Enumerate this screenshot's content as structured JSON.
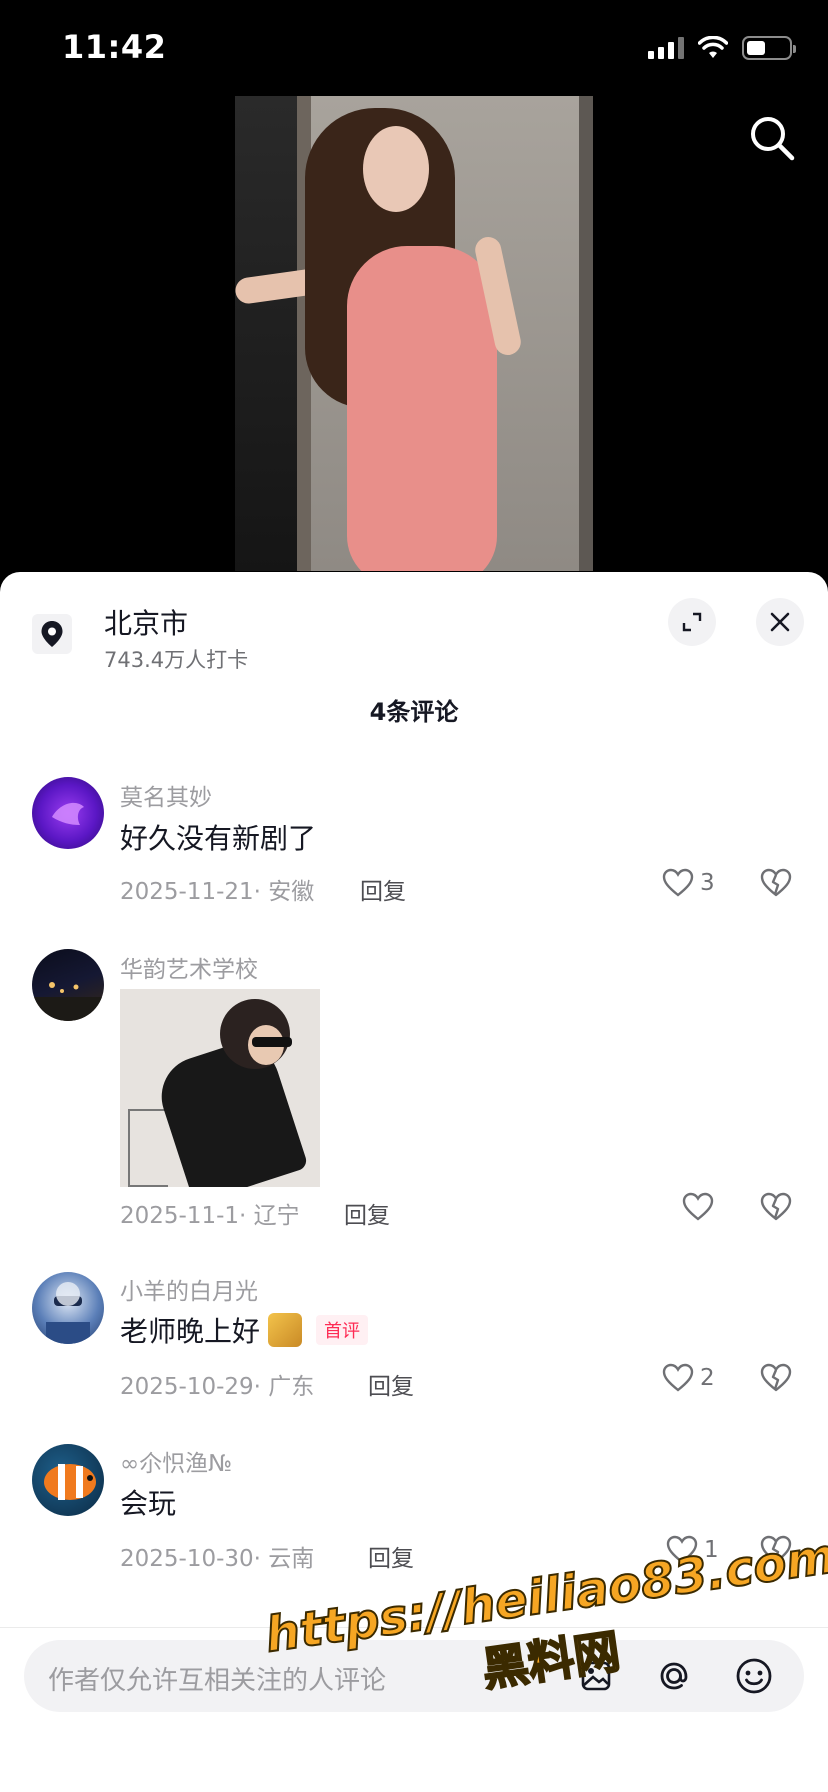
{
  "status_bar": {
    "time": "11:42"
  },
  "location": {
    "title": "北京市",
    "subtitle": "743.4万人打卡"
  },
  "comment_count": "4条评论",
  "comments": [
    {
      "name": "莫名其妙",
      "text": "好久没有新剧了",
      "meta": "2025-11-21· 安徽",
      "reply": "回复",
      "likes": "3"
    },
    {
      "name": "华韵艺术学校",
      "text": "",
      "meta": "2025-11-1· 辽宁",
      "reply": "回复",
      "likes": ""
    },
    {
      "name": "小羊的白月光",
      "text": "老师晚上好",
      "badge": "首评",
      "meta": "2025-10-29· 广东",
      "reply": "回复",
      "likes": "2"
    },
    {
      "name": "∞尒怾渔№",
      "text": "会玩",
      "meta": "2025-10-30· 云南",
      "reply": "回复",
      "likes": "1"
    }
  ],
  "input": {
    "placeholder": "作者仅允许互相关注的人评论"
  },
  "watermark": {
    "url": "https://heiliao83.com",
    "name": "黑料网"
  },
  "icons": [
    "search-icon",
    "location-pin-icon",
    "expand-icon",
    "close-icon",
    "heart-icon",
    "broken-heart-icon",
    "image-icon",
    "at-icon",
    "emoji-icon"
  ]
}
